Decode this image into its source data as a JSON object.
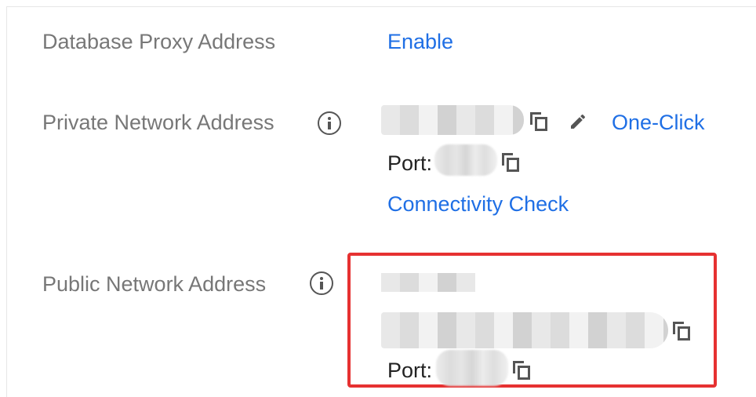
{
  "proxy": {
    "label": "Database Proxy Address",
    "enable_link": "Enable"
  },
  "private": {
    "label": "Private Network Address",
    "port_label": "Port:",
    "one_click_link": "One-Click",
    "connectivity_link": "Connectivity Check"
  },
  "public": {
    "label": "Public Network Address",
    "port_label": "Port:"
  },
  "colors": {
    "link": "#1f6fe5",
    "label": "#777777",
    "highlight": "#e63131"
  }
}
